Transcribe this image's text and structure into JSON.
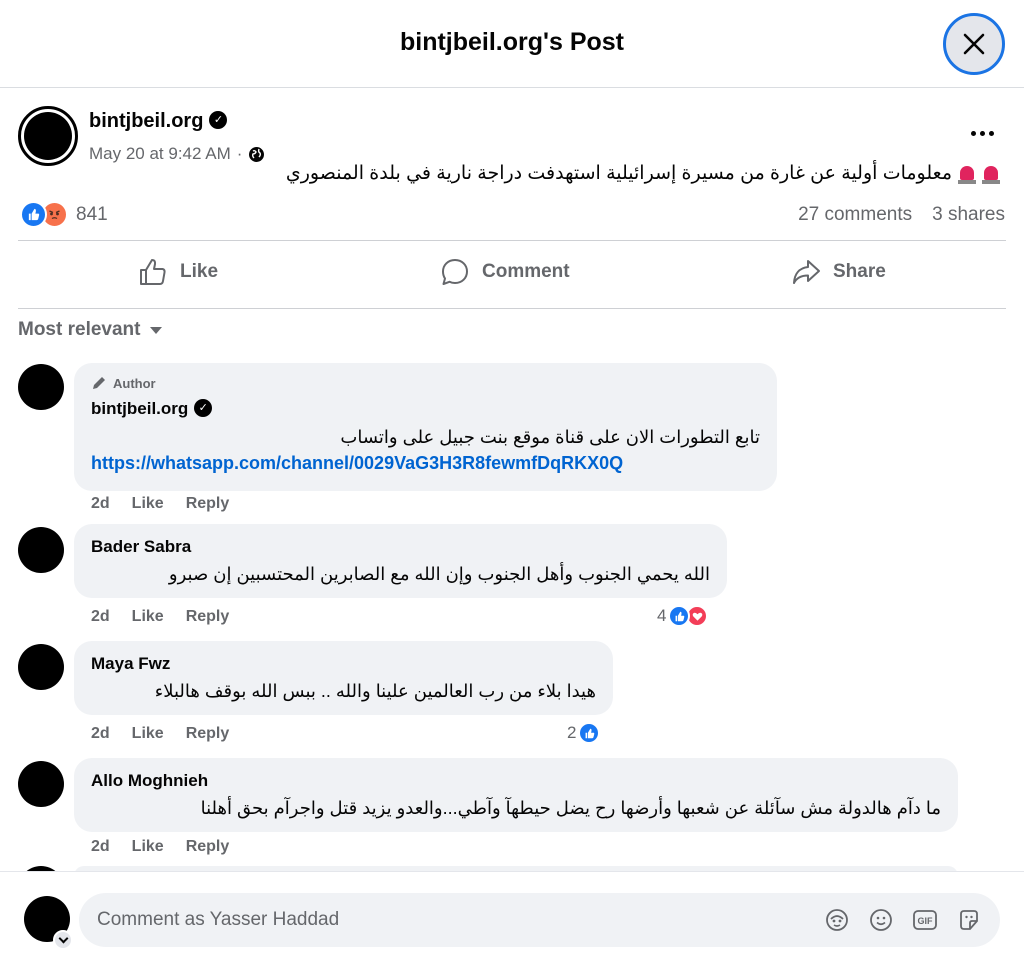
{
  "header": {
    "title": "bintjbeil.org's Post"
  },
  "post": {
    "author": "bintjbeil.org",
    "date": "May 20 at 9:42 AM",
    "separator": "·",
    "text": "معلومات أولية عن غارة من مسيرة إسرائيلية استهدفت دراجة نارية في بلدة المنصوري",
    "reaction_count": "841",
    "comments_count": "27 comments",
    "shares_count": "3 shares"
  },
  "actions": {
    "like": "Like",
    "comment": "Comment",
    "share": "Share"
  },
  "sort": {
    "label": "Most relevant"
  },
  "comments": [
    {
      "badge": "Author",
      "name": "bintjbeil.org",
      "text": "تابع التطورات الان على قناة موقع بنت جبيل على واتساب",
      "link": "https://whatsapp.com/channel/0029VaG3H3R8fewmfDqRKX0Q",
      "age": "2d",
      "like": "Like",
      "reply": "Reply"
    },
    {
      "name": "Bader Sabra",
      "text": "الله يحمي الجنوب وأهل الجنوب وإن الله مع الصابرين المحتسبين إن صبرو",
      "age": "2d",
      "like": "Like",
      "reply": "Reply",
      "reactions": "4"
    },
    {
      "name": "Maya Fwz",
      "text": "هيدا بلاء من رب العالمين علينا والله .. ببس الله بوقف هالبلاء",
      "age": "2d",
      "like": "Like",
      "reply": "Reply",
      "reactions": "2"
    },
    {
      "name": "Allo Moghnieh",
      "text": "ما دآم هالدولة مش سآئلة عن شعبها وأرضها رح يضل حيطهآ وآطي...والعدو يزيد قتل واجرآم بحق أهلنا",
      "age": "2d",
      "like": "Like",
      "reply": "Reply"
    }
  ],
  "composer": {
    "placeholder": "Comment as Yasser Haddad"
  },
  "icons": {
    "close": "close-icon",
    "verified": "verified-badge-icon",
    "globe": "globe-icon",
    "like": "thumbs-up-icon",
    "comment": "speech-bubble-icon",
    "share": "share-arrow-icon",
    "avatar_sticker": "avatar-sticker-icon",
    "emoji": "emoji-icon",
    "gif": "gif-icon",
    "sticker": "sticker-icon"
  },
  "colors": {
    "accent": "#1877f2",
    "link": "#0064d1",
    "muted": "#65676b",
    "bubble": "#f0f2f5",
    "love": "#f33e58",
    "angry": "#f7714b"
  }
}
